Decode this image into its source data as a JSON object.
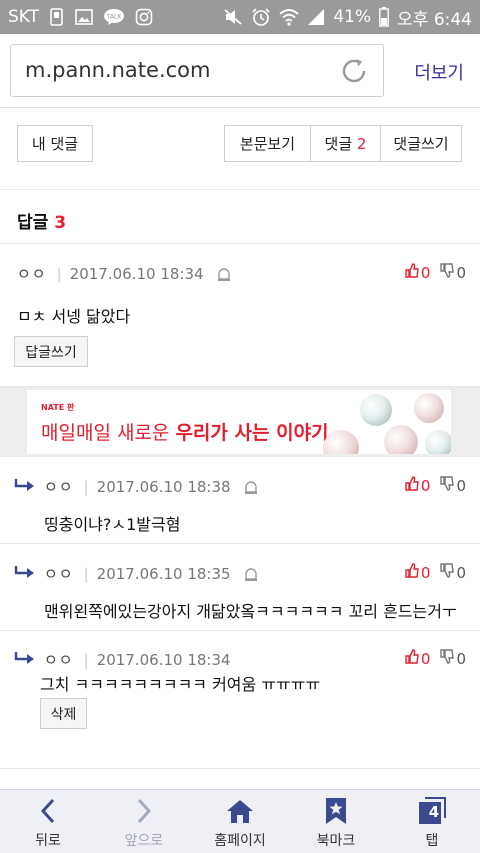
{
  "status_bar": {
    "carrier": "SKT",
    "battery": "41%",
    "time": "오후 6:44",
    "icons": [
      "sim-icon",
      "image-icon",
      "talk-icon",
      "instagram-icon",
      "mute-icon",
      "alarm-icon",
      "wifi-icon",
      "signal-icon",
      "battery-icon"
    ]
  },
  "address_bar": {
    "url": "m.pann.nate.com",
    "more_label": "더보기"
  },
  "tabs": {
    "my_comments": "내 댓글",
    "view_post": "본문보기",
    "comments_label": "댓글",
    "comments_count": "2",
    "write_comment": "댓글쓰기"
  },
  "replies_header": {
    "label": "답글",
    "count": "3"
  },
  "main_comment": {
    "author": "ㅇㅇ",
    "timestamp": "2017.06.10 18:34",
    "likes": "0",
    "dislikes": "0",
    "text": "ㅁㅊ 서넹 닮았다",
    "reply_button": "답글쓰기"
  },
  "ad": {
    "brand": "NATE 판",
    "slogan_prefix": "매일매일 새로운 ",
    "slogan_bold": "우리가 사는 이야기."
  },
  "replies": [
    {
      "author": "ㅇㅇ",
      "timestamp": "2017.06.10 18:38",
      "likes": "0",
      "dislikes": "0",
      "text": "띵충이냐?ㅅ1발극혐"
    },
    {
      "author": "ㅇㅇ",
      "timestamp": "2017.06.10 18:35",
      "likes": "0",
      "dislikes": "0",
      "text": "맨위왼쪽에있는강아지 개닮았옼ㅋㅋㅋㅋㅋㅋ 꼬리 흔드는거ㅜ"
    },
    {
      "author": "ㅇㅇ",
      "timestamp": "2017.06.10 18:34",
      "likes": "0",
      "dislikes": "0",
      "text": "그치 ㅋㅋㅋㅋㅋㅋㅋㅋㅋ 커여움 ㅠㅠㅠㅠ",
      "delete_button": "삭제"
    }
  ],
  "bottom_nav": {
    "back": "뒤로",
    "forward": "앞으로",
    "home": "홈페이지",
    "bookmark": "북마크",
    "tabs": "탭",
    "tab_count": "4"
  },
  "colors": {
    "accent_red": "#e0202f",
    "link_purple": "#3a2fa3",
    "nav_blue": "#3b4a8f"
  }
}
